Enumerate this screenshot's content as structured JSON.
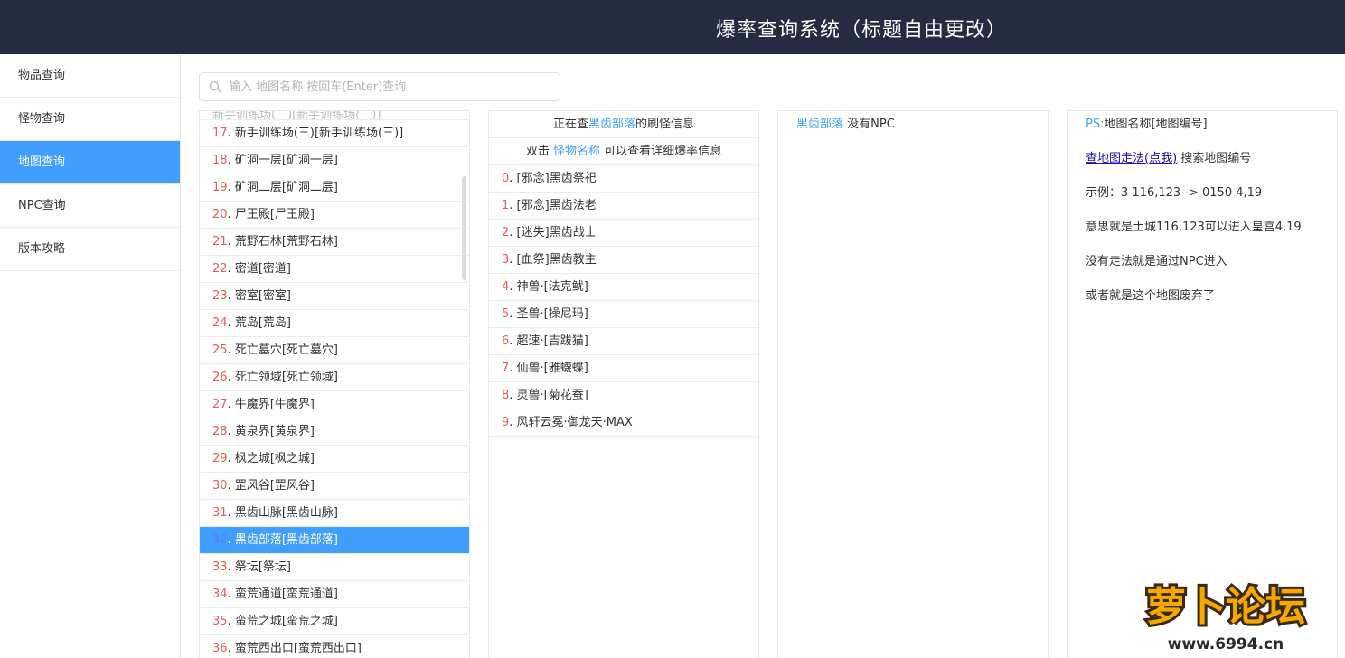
{
  "header": {
    "title": "爆率查询系统（标题自由更改）"
  },
  "sidebar": {
    "items": [
      {
        "label": "物品查询"
      },
      {
        "label": "怪物查询"
      },
      {
        "label": "地图查询"
      },
      {
        "label": "NPC查询"
      },
      {
        "label": "版本攻略"
      }
    ],
    "active_index": 2
  },
  "search": {
    "placeholder": "输入 地图名称 按回车(Enter)查询",
    "value": ""
  },
  "map_list": {
    "partial_row": "新手训练场(二)[新手训练场(二)]",
    "rows": [
      {
        "num": "17",
        "name": "新手训练场(三)[新手训练场(三)]"
      },
      {
        "num": "18",
        "name": "矿洞一层[矿洞一层]"
      },
      {
        "num": "19",
        "name": "矿洞二层[矿洞二层]"
      },
      {
        "num": "20",
        "name": "尸王殿[尸王殿]"
      },
      {
        "num": "21",
        "name": "荒野石林[荒野石林]"
      },
      {
        "num": "22",
        "name": "密道[密道]"
      },
      {
        "num": "23",
        "name": "密室[密室]"
      },
      {
        "num": "24",
        "name": "荒岛[荒岛]"
      },
      {
        "num": "25",
        "name": "死亡墓穴[死亡墓穴]"
      },
      {
        "num": "26",
        "name": "死亡领域[死亡领域]"
      },
      {
        "num": "27",
        "name": "牛魔界[牛魔界]"
      },
      {
        "num": "28",
        "name": "黄泉界[黄泉界]"
      },
      {
        "num": "29",
        "name": "枫之城[枫之城]"
      },
      {
        "num": "30",
        "name": "罡风谷[罡风谷]"
      },
      {
        "num": "31",
        "name": "黑齿山脉[黑齿山脉]"
      },
      {
        "num": "32",
        "name": "黑齿部落[黑齿部落]"
      },
      {
        "num": "33",
        "name": "祭坛[祭坛]"
      },
      {
        "num": "34",
        "name": "蛮荒通道[蛮荒通道]"
      },
      {
        "num": "35",
        "name": "蛮荒之城[蛮荒之城]"
      },
      {
        "num": "36",
        "name": "蛮荒西出口[蛮荒西出口]"
      }
    ],
    "selected_num": "32"
  },
  "monster_panel": {
    "title_prefix": "正在查",
    "title_map": "黑齿部落",
    "title_suffix": "的刷怪信息",
    "hint_prefix": "双击",
    "hint_link": "怪物名称",
    "hint_suffix": "可以查看详细爆率信息",
    "rows": [
      {
        "num": "0",
        "name": "[邪念]黑齿祭祀"
      },
      {
        "num": "1",
        "name": "[邪念]黑齿法老"
      },
      {
        "num": "2",
        "name": "[迷失]黑齿战士"
      },
      {
        "num": "3",
        "name": "[血祭]黑齿教主"
      },
      {
        "num": "4",
        "name": "神兽·[法克鱿]"
      },
      {
        "num": "5",
        "name": "圣兽·[操尼玛]"
      },
      {
        "num": "6",
        "name": "超速·[吉跋猫]"
      },
      {
        "num": "7",
        "name": "仙兽·[雅蠛蝶]"
      },
      {
        "num": "8",
        "name": "灵兽·[菊花蚕]"
      },
      {
        "num": "9",
        "name": "风轩云冕·御龙天·MAX"
      }
    ]
  },
  "npc_panel": {
    "map_name": "黑齿部落",
    "text": "没有NPC"
  },
  "help_panel": {
    "ps_label": "PS:",
    "ps_text": "地图名称[地图编号]",
    "link_text": "查地图走法(点我)",
    "link_suffix": "搜索地图编号",
    "example": "示例：3 116,123 -> 0150 4,19",
    "meaning": "意思就是土城116,123可以进入皇宫4,19",
    "npc_note": "没有走法就是通过NPC进入",
    "abandoned": "或者就是这个地图废弃了"
  },
  "watermark": {
    "logo_text": "萝卜论坛",
    "url": "www.6994.cn"
  },
  "colors": {
    "header_bg": "#252c41",
    "accent": "#409eff",
    "index_red": "#e85a5a",
    "link_blue": "#1a0dab"
  }
}
